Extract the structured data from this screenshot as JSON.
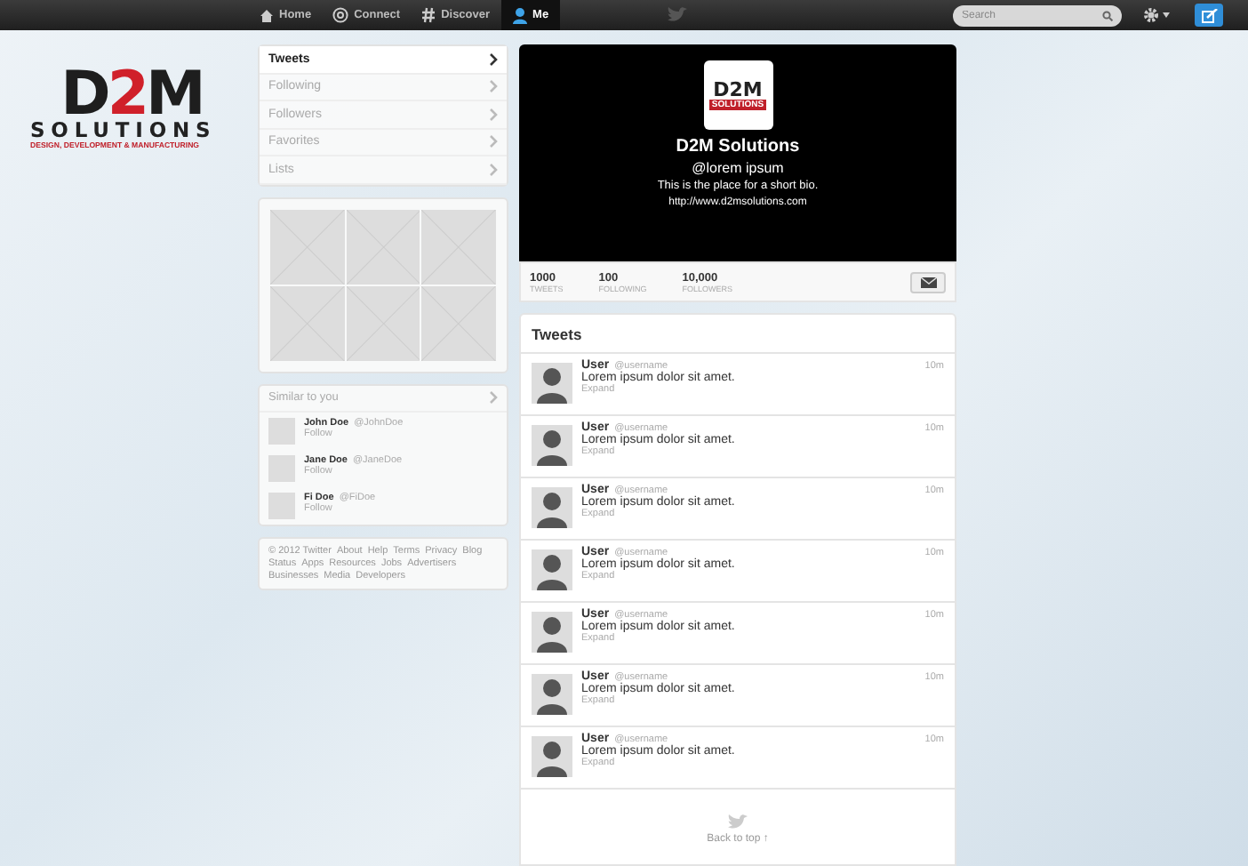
{
  "topbar": {
    "nav": [
      {
        "label": "Home",
        "selected": false
      },
      {
        "label": "Connect",
        "selected": false
      },
      {
        "label": "Discover",
        "selected": false
      },
      {
        "label": "Me",
        "selected": true
      }
    ],
    "search": {
      "placeholder": "Search"
    }
  },
  "logo": {
    "mark": [
      {
        "text": "D",
        "color": "#1e1e1e"
      },
      {
        "text": "2",
        "color": "#d0202a"
      },
      {
        "text": "M",
        "color": "#1e1e1e"
      }
    ],
    "name": "SOLUTIONS",
    "tagline": "DESIGN, DEVELOPMENT & MANUFACTURING"
  },
  "sidebar": {
    "menu": [
      {
        "label": "Tweets",
        "selected": true
      },
      {
        "label": "Following",
        "selected": false
      },
      {
        "label": "Followers",
        "selected": false
      },
      {
        "label": "Favorites",
        "selected": false
      },
      {
        "label": "Lists",
        "selected": false
      }
    ],
    "similar": {
      "title": "Similar to you",
      "users": [
        {
          "name": "John Doe",
          "handle": "@JohnDoe",
          "action": "Follow"
        },
        {
          "name": "Jane Doe",
          "handle": "@JaneDoe",
          "action": "Follow"
        },
        {
          "name": "Fi Doe",
          "handle": "@FiDoe",
          "action": "Follow"
        }
      ]
    },
    "footer_links": [
      "© 2012 Twitter",
      "About",
      "Help",
      "Terms",
      "Privacy",
      "Blog",
      "Status",
      "Apps",
      "Resources",
      "Jobs",
      "Advertisers",
      "Businesses",
      "Media",
      "Developers"
    ]
  },
  "profile": {
    "avatar": {
      "mark": "D2M",
      "name": "SOLUTIONS"
    },
    "name": "D2M Solutions",
    "handle": "@lorem ipsum",
    "bio": "This is the place for a short bio.",
    "url": "http://www.d2msolutions.com",
    "stats": [
      {
        "value": "1000",
        "label": "TWEETS"
      },
      {
        "value": "100",
        "label": "FOLLOWING"
      },
      {
        "value": "10,000",
        "label": "FOLLOWERS"
      }
    ]
  },
  "timeline": {
    "title": "Tweets",
    "tweets": [
      {
        "user": "User",
        "handle": "@username",
        "text": "Lorem ipsum dolor sit amet.",
        "action": "Expand",
        "time": "10m"
      },
      {
        "user": "User",
        "handle": "@username",
        "text": "Lorem ipsum dolor sit amet.",
        "action": "Expand",
        "time": "10m"
      },
      {
        "user": "User",
        "handle": "@username",
        "text": "Lorem ipsum dolor sit amet.",
        "action": "Expand",
        "time": "10m"
      },
      {
        "user": "User",
        "handle": "@username",
        "text": "Lorem ipsum dolor sit amet.",
        "action": "Expand",
        "time": "10m"
      },
      {
        "user": "User",
        "handle": "@username",
        "text": "Lorem ipsum dolor sit amet.",
        "action": "Expand",
        "time": "10m"
      },
      {
        "user": "User",
        "handle": "@username",
        "text": "Lorem ipsum dolor sit amet.",
        "action": "Expand",
        "time": "10m"
      },
      {
        "user": "User",
        "handle": "@username",
        "text": "Lorem ipsum dolor sit amet.",
        "action": "Expand",
        "time": "10m"
      }
    ],
    "back_to_top": "Back to top ↑"
  }
}
